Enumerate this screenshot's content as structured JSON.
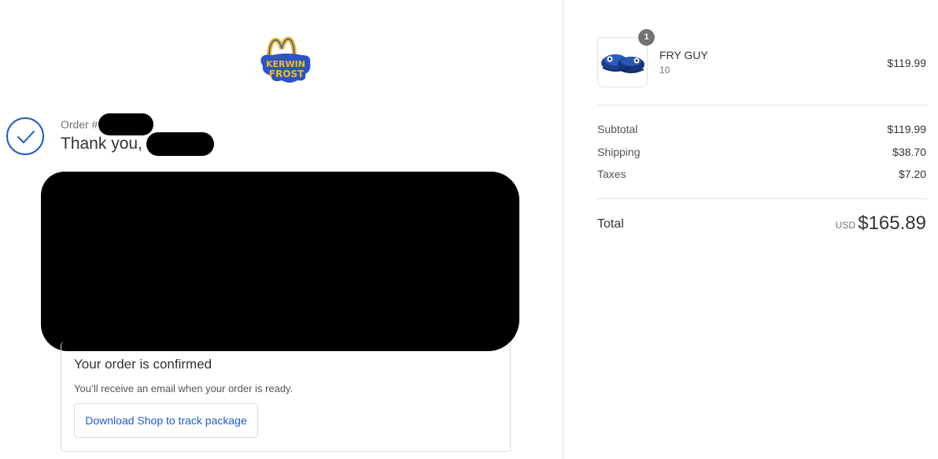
{
  "brand": {
    "logo_text_top": "KERWIN",
    "logo_text_bottom": "FROST",
    "colors": {
      "arches": "#f6b91a",
      "text_fill": "#f6b91a",
      "badge_bg": "#2a55c8"
    }
  },
  "order": {
    "order_label": "Order #",
    "thank_you": "Thank you,"
  },
  "confirmation": {
    "title": "Your order is confirmed",
    "message": "You’ll receive an email when your order is ready.",
    "track_button": "Download Shop to track package"
  },
  "cart": {
    "items": [
      {
        "name": "FRY GUY",
        "variant": "10",
        "price": "$119.99",
        "quantity": "1"
      }
    ]
  },
  "summary": {
    "subtotal_label": "Subtotal",
    "subtotal_value": "$119.99",
    "shipping_label": "Shipping",
    "shipping_value": "$38.70",
    "taxes_label": "Taxes",
    "taxes_value": "$7.20",
    "total_label": "Total",
    "currency": "USD",
    "total_value": "$165.89"
  },
  "colors": {
    "accent": "#1f5bc6",
    "border": "#d9d9d9",
    "text": "#333333",
    "muted": "#737373",
    "redaction": "#000000"
  }
}
